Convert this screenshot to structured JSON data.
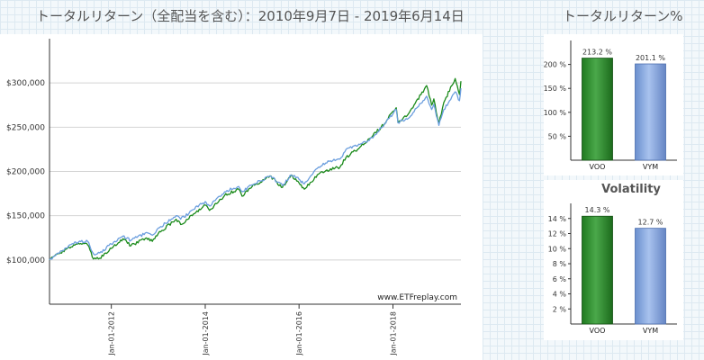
{
  "main_title": "トータルリターン（全配当を含む）：2010年9月7日 - 2019年6月14日",
  "side_title": "トータルリターン%",
  "colors": {
    "voo_line": "#1a8a1a",
    "vym_line": "#6b9ede",
    "voo_bar": "#2a8a2a",
    "vym_bar": "#7d9fd8"
  },
  "chart_data": [
    {
      "type": "line",
      "title": "",
      "xlabel": "",
      "ylabel": "",
      "ylim": [
        50000,
        350000
      ],
      "yticks": [
        "$100,000",
        "$150,000",
        "$200,000",
        "$250,000",
        "$300,000"
      ],
      "ytick_values": [
        100000,
        150000,
        200000,
        250000,
        300000
      ],
      "xticks": [
        "Jan-01-2012",
        "Jan-01-2014",
        "Jan-01-2016",
        "Jan-01-2018"
      ],
      "xtick_values": [
        "2012-01-01",
        "2014-01-01",
        "2016-01-01",
        "2018-01-01"
      ],
      "xlim": [
        "2010-09-07",
        "2019-06-14"
      ],
      "watermark": "www.ETFreplay.com",
      "grid": true,
      "series": [
        {
          "name": "VOO",
          "x": [
            "2010-09-07",
            "2010-12-01",
            "2011-04-01",
            "2011-07-01",
            "2011-08-15",
            "2011-10-03",
            "2012-01-01",
            "2012-04-01",
            "2012-06-01",
            "2012-10-01",
            "2012-11-15",
            "2013-01-01",
            "2013-05-20",
            "2013-06-24",
            "2013-10-01",
            "2014-01-01",
            "2014-02-03",
            "2014-06-01",
            "2014-09-18",
            "2014-10-15",
            "2015-01-01",
            "2015-05-20",
            "2015-08-25",
            "2015-11-01",
            "2016-01-01",
            "2016-02-11",
            "2016-06-01",
            "2016-09-01",
            "2016-11-15",
            "2017-01-01",
            "2017-04-01",
            "2017-07-01",
            "2017-10-01",
            "2018-01-26",
            "2018-02-09",
            "2018-05-01",
            "2018-09-20",
            "2018-10-29",
            "2018-11-15",
            "2018-12-24",
            "2019-02-01",
            "2019-04-30",
            "2019-06-03",
            "2019-06-14"
          ],
          "values": [
            100000,
            108000,
            118000,
            117000,
            101000,
            102000,
            113000,
            124000,
            116000,
            125000,
            121000,
            130000,
            146000,
            140000,
            152000,
            162000,
            156000,
            173000,
            180000,
            172000,
            183000,
            195000,
            182000,
            196000,
            187000,
            180000,
            197000,
            203000,
            205000,
            216000,
            225000,
            237000,
            250000,
            272000,
            255000,
            265000,
            297000,
            275000,
            282000,
            254000,
            278000,
            305000,
            287000,
            302000
          ]
        },
        {
          "name": "VYM",
          "x": [
            "2010-09-07",
            "2010-12-01",
            "2011-04-01",
            "2011-07-01",
            "2011-08-15",
            "2011-10-03",
            "2012-01-01",
            "2012-04-01",
            "2012-06-01",
            "2012-10-01",
            "2012-11-15",
            "2013-01-01",
            "2013-05-20",
            "2013-06-24",
            "2013-10-01",
            "2014-01-01",
            "2014-02-03",
            "2014-06-01",
            "2014-09-18",
            "2014-10-15",
            "2015-01-01",
            "2015-05-20",
            "2015-08-25",
            "2015-11-01",
            "2016-01-01",
            "2016-02-11",
            "2016-06-01",
            "2016-09-01",
            "2016-11-15",
            "2017-01-01",
            "2017-04-01",
            "2017-07-01",
            "2017-10-01",
            "2018-01-26",
            "2018-02-09",
            "2018-05-01",
            "2018-09-20",
            "2018-10-29",
            "2018-11-15",
            "2018-12-24",
            "2019-02-01",
            "2019-04-30",
            "2019-06-03",
            "2019-06-14"
          ],
          "values": [
            100000,
            110000,
            120000,
            121000,
            107000,
            108000,
            118000,
            127000,
            122000,
            131000,
            128000,
            136000,
            150000,
            146000,
            157000,
            166000,
            161000,
            177000,
            183000,
            177000,
            185000,
            195000,
            184000,
            196000,
            191000,
            186000,
            205000,
            212000,
            214000,
            225000,
            229000,
            235000,
            249000,
            270000,
            255000,
            260000,
            285000,
            270000,
            276000,
            252000,
            270000,
            290000,
            280000,
            294000
          ]
        }
      ]
    },
    {
      "type": "bar",
      "title": "",
      "categories": [
        "VOO",
        "VYM"
      ],
      "values": [
        213.2,
        201.1
      ],
      "value_labels": [
        "213.2 %",
        "201.1 %"
      ],
      "ylim": [
        0,
        250
      ],
      "yticks": [
        "50 %",
        "100 %",
        "150 %",
        "200 %"
      ],
      "ytick_values": [
        50,
        100,
        150,
        200
      ]
    },
    {
      "type": "bar",
      "title": "Volatility",
      "categories": [
        "VOO",
        "VYM"
      ],
      "values": [
        14.3,
        12.7
      ],
      "value_labels": [
        "14.3 %",
        "12.7 %"
      ],
      "ylim": [
        0,
        16
      ],
      "yticks": [
        "2 %",
        "4 %",
        "6 %",
        "8 %",
        "10 %",
        "12 %",
        "14 %"
      ],
      "ytick_values": [
        2,
        4,
        6,
        8,
        10,
        12,
        14
      ]
    }
  ]
}
